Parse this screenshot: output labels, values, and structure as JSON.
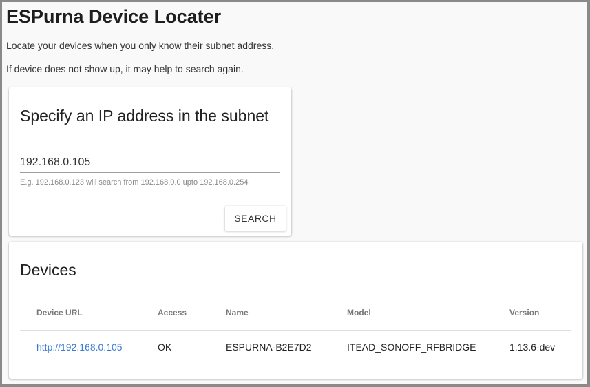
{
  "page": {
    "title": "ESPurna Device Locater",
    "intro_1": "Locate your devices when you only know their subnet address.",
    "intro_2": "If device does not show up, it may help to search again."
  },
  "search": {
    "title": "Specify an IP address in the subnet",
    "value": "192.168.0.105",
    "hint": "E.g. 192.168.0.123 will search from 192.168.0.0 upto 192.168.0.254",
    "button_label": "SEARCH"
  },
  "devices": {
    "title": "Devices",
    "columns": [
      "Device URL",
      "Access",
      "Name",
      "Model",
      "Version"
    ],
    "rows": [
      {
        "url": "http://192.168.0.105",
        "access": "OK",
        "name": "ESPURNA-B2E7D2",
        "model": "ITEAD_SONOFF_RFBRIDGE",
        "version": "1.13.6-dev"
      }
    ]
  },
  "colors": {
    "link": "#3a7bd5",
    "background": "#f9f9f9"
  }
}
